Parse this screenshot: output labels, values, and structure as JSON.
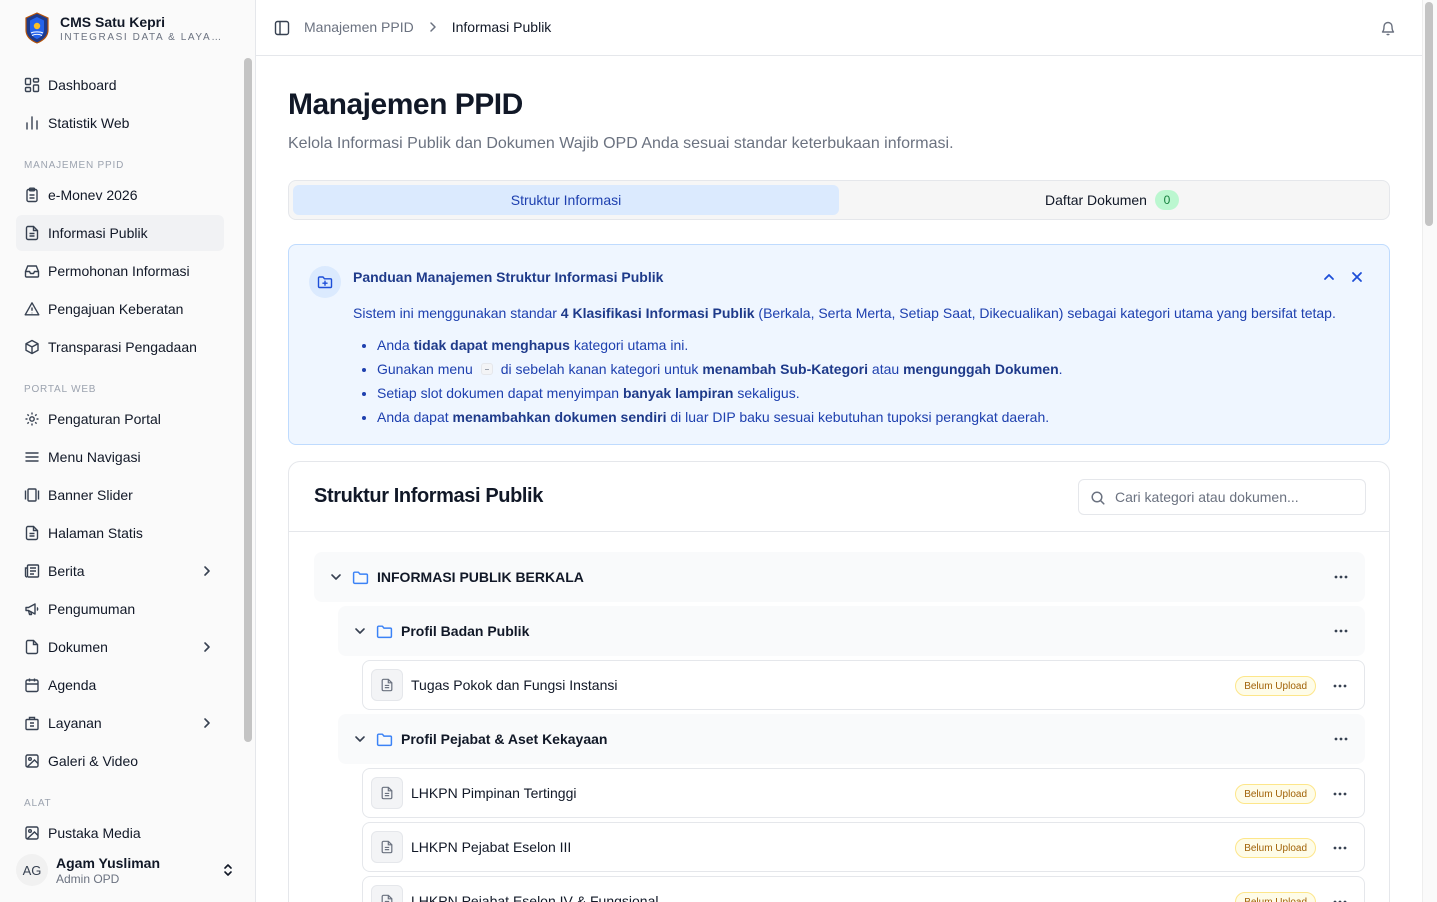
{
  "brand": {
    "title": "CMS Satu Kepri",
    "subtitle": "INTEGRASI DATA & LAYANAN"
  },
  "nav": {
    "dashboard": "Dashboard",
    "statistik": "Statistik Web",
    "section_ppid": "MANAJEMEN PPID",
    "emonev": "e-Monev 2026",
    "informasi_publik": "Informasi Publik",
    "permohonan": "Permohonan Informasi",
    "keberatan": "Pengajuan Keberatan",
    "pengadaan": "Transparasi Pengadaan",
    "section_portal": "PORTAL WEB",
    "pengaturan": "Pengaturan Portal",
    "menu_navigasi": "Menu Navigasi",
    "banner": "Banner Slider",
    "halaman": "Halaman Statis",
    "berita": "Berita",
    "pengumuman": "Pengumuman",
    "dokumen": "Dokumen",
    "agenda": "Agenda",
    "layanan": "Layanan",
    "galeri": "Galeri & Video",
    "section_alat": "ALAT",
    "pustaka": "Pustaka Media"
  },
  "user": {
    "initials": "AG",
    "name": "Agam Yusliman",
    "role": "Admin OPD"
  },
  "breadcrumb": {
    "parent": "Manajemen PPID",
    "current": "Informasi Publik"
  },
  "page": {
    "title": "Manajemen PPID",
    "description": "Kelola Informasi Publik dan Dokumen Wajib OPD Anda sesuai standar keterbukaan informasi."
  },
  "tabs": {
    "struktur": "Struktur Informasi",
    "daftar": "Daftar Dokumen",
    "daftar_count": "0"
  },
  "guide": {
    "title": "Panduan Manajemen Struktur Informasi Publik",
    "intro_1": "Sistem ini menggunakan standar ",
    "intro_bold": "4 Klasifikasi Informasi Publik",
    "intro_2": " (Berkala, Serta Merta, Setiap Saat, Dikecualikan) sebagai kategori utama yang bersifat tetap.",
    "b1_pre": "Anda ",
    "b1_bold": "tidak dapat menghapus",
    "b1_post": " kategori utama ini.",
    "b2_pre": "Gunakan menu",
    "b2_mid": "di sebelah kanan kategori untuk ",
    "b2_bold1": "menambah Sub-Kategori",
    "b2_and": " atau ",
    "b2_bold2": "mengunggah Dokumen",
    "b2_end": ".",
    "b3_pre": "Setiap slot dokumen dapat menyimpan ",
    "b3_bold": "banyak lampiran",
    "b3_post": " sekaligus.",
    "b4_pre": "Anda dapat ",
    "b4_bold": "menambahkan dokumen sendiri",
    "b4_post": " di luar DIP baku sesuai kebutuhan tupoksi perangkat daerah."
  },
  "struktur": {
    "title": "Struktur Informasi Publik",
    "search_placeholder": "Cari kategori atau dokumen...",
    "status_label": "Belum Upload",
    "root": "INFORMASI PUBLIK BERKALA",
    "folder_1": "Profil Badan Publik",
    "doc_1": "Tugas Pokok dan Fungsi Instansi",
    "folder_2": "Profil Pejabat & Aset Kekayaan",
    "doc_2": "LHKPN Pimpinan Tertinggi",
    "doc_3": "LHKPN Pejabat Eselon III",
    "doc_4": "LHKPN Pejabat Eselon IV & Fungsional"
  },
  "colors": {
    "accent": "#1e40af",
    "active_tab": "#dbeafe",
    "folder": "#3b82f6",
    "warning": "#a16207"
  }
}
